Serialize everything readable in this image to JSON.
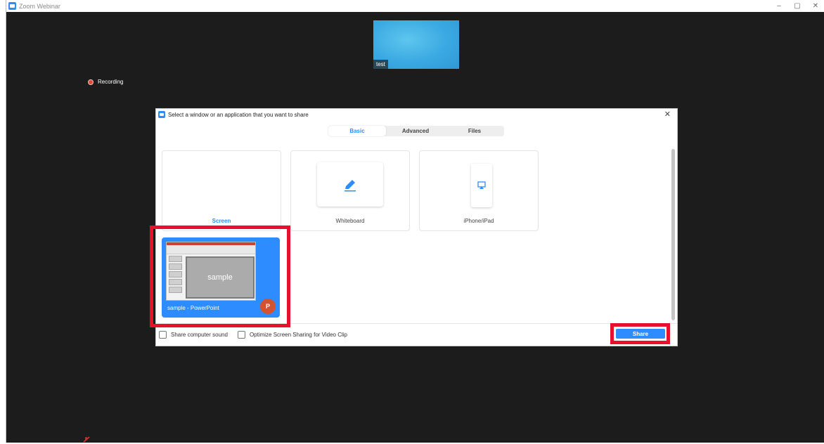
{
  "window": {
    "title": "Zoom Webinar",
    "controls": {
      "minimize": "–",
      "maximize": "▢",
      "close": "✕"
    }
  },
  "video": {
    "participant_name": "test",
    "tile_color": "#3aa9e2"
  },
  "status": {
    "recording_label": "Recording"
  },
  "dialog": {
    "title": "Select a window or an application that you want to share",
    "close_glyph": "✕",
    "tabs": [
      {
        "label": "Basic",
        "active": true
      },
      {
        "label": "Advanced",
        "active": false
      },
      {
        "label": "Files",
        "active": false
      }
    ],
    "options": {
      "screen_label": "Screen",
      "whiteboard_label": "Whiteboard",
      "iphone_label": "iPhone/iPad"
    },
    "app_window": {
      "name": "sample - PowerPoint",
      "slide_text": "sample",
      "badge": "P"
    },
    "footer": {
      "share_sound_label": "Share computer sound",
      "optimize_label": "Optimize Screen Sharing for Video Clip"
    },
    "share_label": "Share"
  },
  "colors": {
    "accent": "#2d8cff",
    "highlight": "#e8112d",
    "background": "#1c1c1c"
  }
}
